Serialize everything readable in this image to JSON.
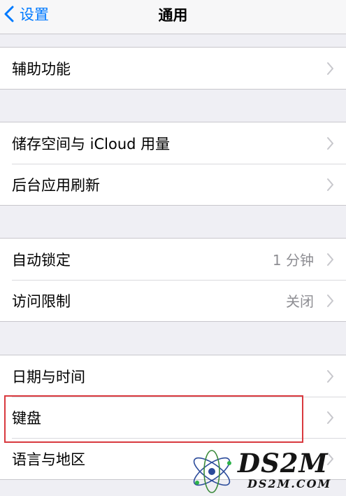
{
  "navbar": {
    "back_label": "设置",
    "title": "通用"
  },
  "groups": [
    {
      "rows": [
        {
          "label": "辅助功能",
          "value": ""
        }
      ]
    },
    {
      "rows": [
        {
          "label": "储存空间与 iCloud 用量",
          "value": ""
        },
        {
          "label": "后台应用刷新",
          "value": ""
        }
      ]
    },
    {
      "rows": [
        {
          "label": "自动锁定",
          "value": "1 分钟"
        },
        {
          "label": "访问限制",
          "value": "关闭"
        }
      ]
    },
    {
      "rows": [
        {
          "label": "日期与时间",
          "value": ""
        },
        {
          "label": "键盘",
          "value": ""
        },
        {
          "label": "语言与地区",
          "value": ""
        }
      ]
    }
  ],
  "watermark": {
    "text": "DS2M",
    "subtext": "DS2M.COM"
  },
  "colors": {
    "accent": "#007aff",
    "background": "#efeff4",
    "highlight": "#d9393e",
    "secondary_text": "#8e8e93",
    "chevron": "#c7c7cc"
  },
  "icons": {
    "back": "chevron-left-icon",
    "disclosure": "chevron-right-icon"
  }
}
